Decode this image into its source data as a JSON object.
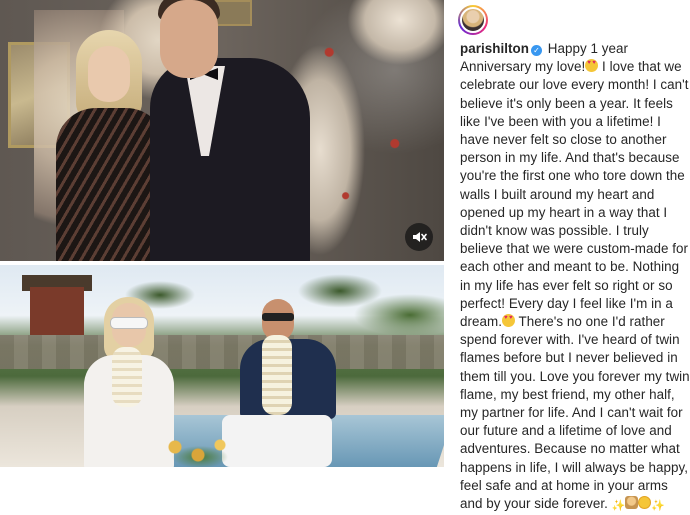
{
  "post": {
    "username": "parishilton",
    "verified_icon": "verified-badge-icon",
    "caption_intro": "Happy 1 year Anniversary my love!",
    "caption_body": " I love that we celebrate our love every month! I can't believe it's only been a year. It feels like I've been with you a lifetime! I have never felt so close to another person in my life. And that's because you're the first one who tore down the walls I built around my heart and opened up my heart in a way that I didn't know was possible. I truly believe that we were custom-made for each other and meant to be. Nothing in my life has ever felt so right or so perfect! Every day I feel like I'm in a dream.",
    "caption_end": " There's no one I'd rather spend forever with. I've heard of twin flames before but I never believed in them till you. Love you forever my twin flame, my best friend, my other half, my partner for life. And I can't wait for our future and a lifetime of love and adventures. Because no matter what happens in life, I will always be happy, feel safe and at home in your arms and by your side forever. ",
    "emoji_icons": [
      "heart-eyes-emoji-icon",
      "sparkles-emoji-icon",
      "couple-emoji-icon",
      "angel-face-emoji-icon"
    ]
  },
  "media": {
    "top_photo": "couple-formal-christmas-photo",
    "bottom_photo": "couple-beach-canoe-photo",
    "mute_icon": "muted-speaker-icon"
  },
  "colors": {
    "verified": "#3897f0",
    "text": "#262626",
    "avatar_ring": [
      "#f9ce34",
      "#ee2a7b",
      "#6228d7"
    ]
  }
}
